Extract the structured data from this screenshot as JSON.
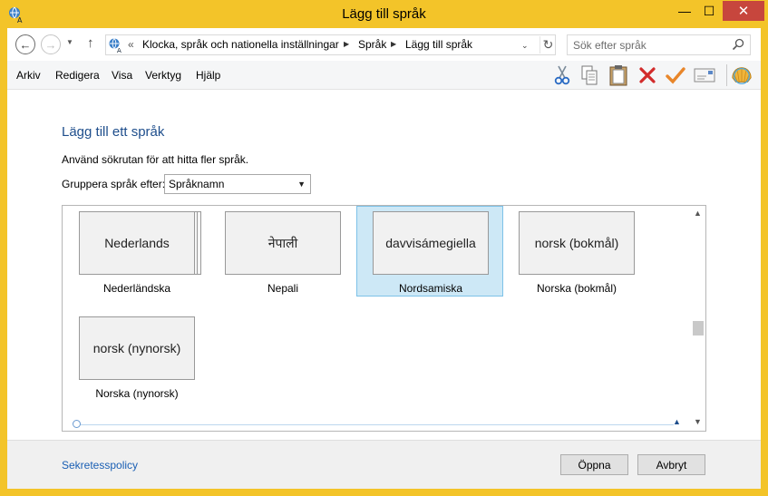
{
  "window": {
    "title": "Lägg till språk",
    "minimize_glyph": "—",
    "maximize_glyph": "☐",
    "close_glyph": "✕",
    "frame_color": "#f3c429"
  },
  "address_bar": {
    "breadcrumb_prefix": "«",
    "crumbs": [
      "Klocka, språk och nationella inställningar",
      "Språk",
      "Lägg till språk"
    ],
    "back_glyph": "←",
    "forward_glyph": "→",
    "up_glyph": "↑",
    "refresh_glyph": "↻"
  },
  "search": {
    "placeholder": "Sök efter språk"
  },
  "menu": {
    "items": [
      "Arkiv",
      "Redigera",
      "Visa",
      "Verktyg",
      "Hjälp"
    ]
  },
  "toolbar": {
    "icons": [
      "scissors-icon",
      "copy-icon",
      "paste-icon",
      "delete-icon",
      "checkmark-icon",
      "envelope-icon",
      "shell-icon"
    ]
  },
  "main": {
    "heading": "Lägg till ett språk",
    "instruction": "Använd sökrutan för att hitta fler språk.",
    "group_label": "Gruppera språk efter:",
    "group_value": "Språknamn",
    "tiles": [
      {
        "native": "Nederlands",
        "caption": "Nederländska",
        "stacked": true,
        "selected": false
      },
      {
        "native": "नेपाली",
        "caption": "Nepali",
        "stacked": false,
        "selected": false
      },
      {
        "native": "davvisámegiella",
        "caption": "Nordsamiska",
        "stacked": true,
        "selected": true
      },
      {
        "native": "norsk (bokmål)",
        "caption": "Norska (bokmål)",
        "stacked": false,
        "selected": false
      },
      {
        "native": "norsk (nynorsk)",
        "caption": "Norska (nynorsk)",
        "stacked": false,
        "selected": false
      }
    ]
  },
  "footer": {
    "privacy_link": "Sekretesspolicy",
    "open_button": "Öppna",
    "cancel_button": "Avbryt"
  }
}
